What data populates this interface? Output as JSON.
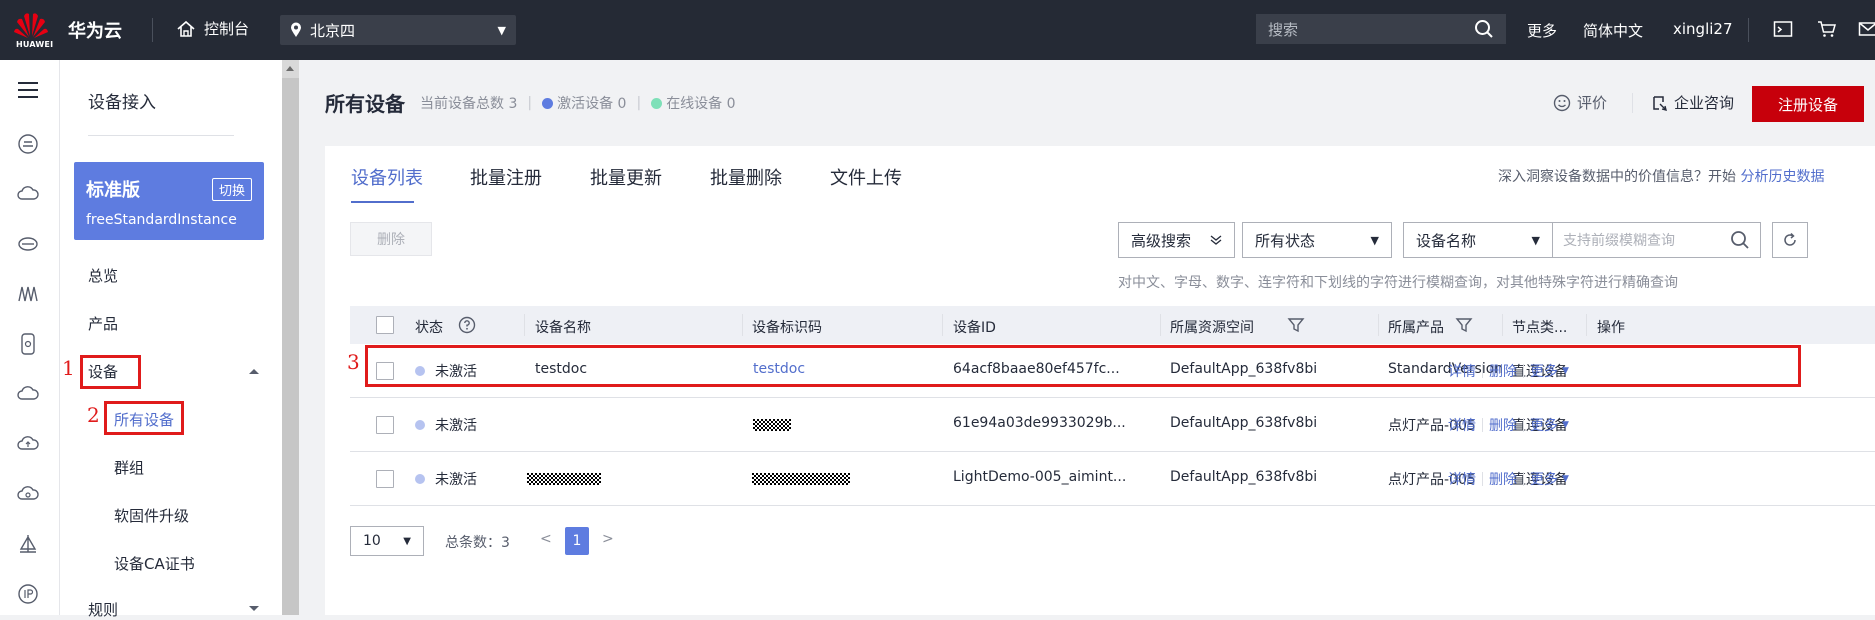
{
  "topbar": {
    "logo_text": "HUAWEI",
    "brand": "华为云",
    "console": "控制台",
    "region": "北京四",
    "search_placeholder": "搜索",
    "more": "更多",
    "language": "简体中文",
    "user": "xingli27"
  },
  "sidebar": {
    "title": "设备接入",
    "edition_name": "标准版",
    "edition_switch": "切换",
    "instance": "freeStandardInstance",
    "items": [
      "总览",
      "产品",
      "设备",
      "所有设备",
      "群组",
      "软固件升级",
      "设备CA证书",
      "规则"
    ]
  },
  "annotations": {
    "n1": "1",
    "n2": "2",
    "n3": "3"
  },
  "page": {
    "title": "所有设备",
    "total_label": "当前设备总数",
    "total_value": "3",
    "active_label": "激活设备",
    "active_value": "0",
    "online_label": "在线设备",
    "online_value": "0",
    "rate": "评价",
    "consult": "企业咨询",
    "register": "注册设备"
  },
  "tabs": [
    "设备列表",
    "批量注册",
    "批量更新",
    "批量删除",
    "文件上传"
  ],
  "hint": {
    "text": "深入洞察设备数据中的价值信息？开始",
    "link": "分析历史数据"
  },
  "toolbar": {
    "delete": "删除",
    "advanced": "高级搜索",
    "status": "所有状态",
    "field": "设备名称",
    "search_placeholder": "支持前缀模糊查询",
    "fuzzy_note": "对中文、字母、数字、连字符和下划线的字符进行模糊查询，对其他特殊字符进行精确查询"
  },
  "table": {
    "headers": [
      "状态",
      "设备名称",
      "设备标识码",
      "设备ID",
      "所属资源空间",
      "所属产品",
      "节点类...",
      "操作"
    ],
    "rows": [
      {
        "status": "未激活",
        "name": "testdoc",
        "code": "testdoc",
        "id": "64acf8baae80ef457fc...",
        "space": "DefaultApp_638fv8bi",
        "product": "StandardVersion",
        "node": "直连设备"
      },
      {
        "status": "未激活",
        "name": "",
        "code": "",
        "id": "61e94a03de9933029b...",
        "space": "DefaultApp_638fv8bi",
        "product": "点灯产品-005",
        "node": "直连设备"
      },
      {
        "status": "未激活",
        "name": "",
        "code": "",
        "id": "LightDemo-005_aimint...",
        "space": "DefaultApp_638fv8bi",
        "product": "点灯产品-005",
        "node": "直连设备"
      }
    ],
    "ops": [
      "详情",
      "删除",
      "更多"
    ]
  },
  "pagination": {
    "page_size": "10",
    "total": "总条数：3",
    "current": "1"
  },
  "colors": {
    "topbar": "#252a35",
    "accent": "#526ecc",
    "edition": "#5e7ce0",
    "register": "#c7000b",
    "annotation": "#e01b1b",
    "active_dot": "#5e7ce0",
    "online_dot": "#7ee0b8"
  }
}
